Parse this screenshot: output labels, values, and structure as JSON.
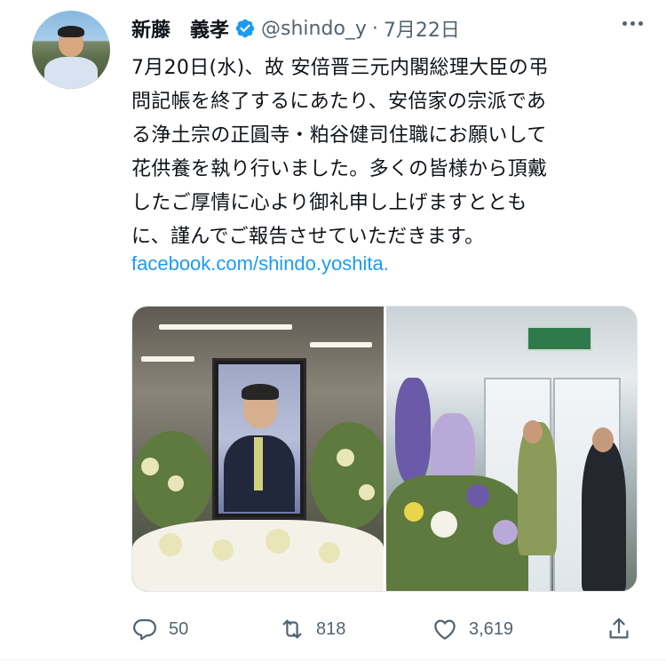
{
  "author": {
    "display_name": "新藤　義孝",
    "handle": "@shindo_y",
    "separator": "·",
    "date": "7月22日",
    "verified": true
  },
  "tweet": {
    "lines": [
      "7月20日(水)、故 安倍晋三元内閣総理大臣の弔",
      "問記帳を終了するにあたり、安倍家の宗派であ",
      "る浄土宗の正圓寺・粕谷健司住職にお願いして",
      "花供養を執り行いました。多くの皆様から頂戴",
      "したご厚情に心より御礼申し上げますととも",
      "に、謹んでご報告させていただきます。"
    ],
    "link": "facebook.com/shindo.yoshita."
  },
  "actions": {
    "reply_count": "50",
    "retweet_count": "818",
    "like_count": "3,619"
  },
  "colors": {
    "text": "#0f1419",
    "secondary": "#536471",
    "link": "#1d9bf0",
    "verified": "#1d9bf0"
  },
  "icons": [
    "reply-icon",
    "retweet-icon",
    "like-icon",
    "share-icon",
    "verified-badge-icon",
    "more-icon"
  ]
}
